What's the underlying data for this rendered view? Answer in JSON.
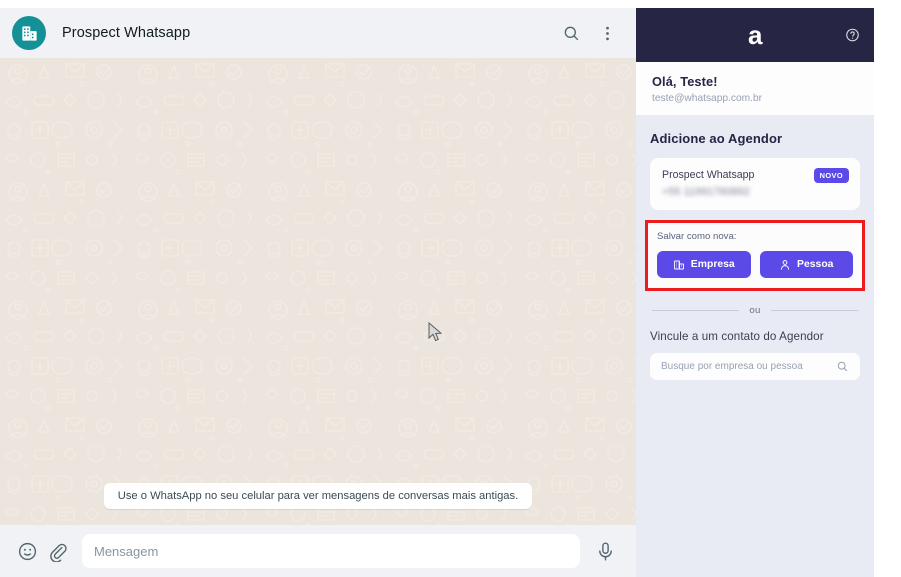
{
  "whatsapp": {
    "contact_name": "Prospect Whatsapp",
    "avatar_icon": "building-icon",
    "search_icon": "search-icon",
    "menu_icon": "overflow-menu-icon",
    "notice": "Use o WhatsApp no seu celular para ver mensagens de conversas mais antigas.",
    "emoji_icon": "emoji-icon",
    "attach_icon": "paperclip-icon",
    "message_placeholder": "Mensagem",
    "mic_icon": "microphone-icon",
    "background_color": "#ece5dd",
    "header_color": "#f0f2f5",
    "avatar_color": "#149097"
  },
  "panel": {
    "logo": "a",
    "help_icon": "help-circle-icon",
    "header_color": "#262544",
    "background_color": "#e8eaf4",
    "accent_color": "#5b4ae8",
    "highlight_color": "#ed1b1b",
    "user": {
      "greeting": "Olá, Teste!",
      "email": "teste@whatsapp.com.br"
    },
    "add_section": {
      "title": "Adicione ao Agendor",
      "card": {
        "name": "Prospect Whatsapp",
        "phone": "+55 11991760892",
        "badge": "NOVO"
      },
      "save_label": "Salvar como nova:",
      "buttons": [
        {
          "label": "Empresa",
          "icon": "company-building-icon"
        },
        {
          "label": "Pessoa",
          "icon": "person-icon"
        }
      ]
    },
    "divider_text": "ou",
    "link_section": {
      "title": "Vincule a um contato do Agendor",
      "search_placeholder": "Busque por empresa ou pessoa",
      "search_icon": "search-icon"
    }
  }
}
